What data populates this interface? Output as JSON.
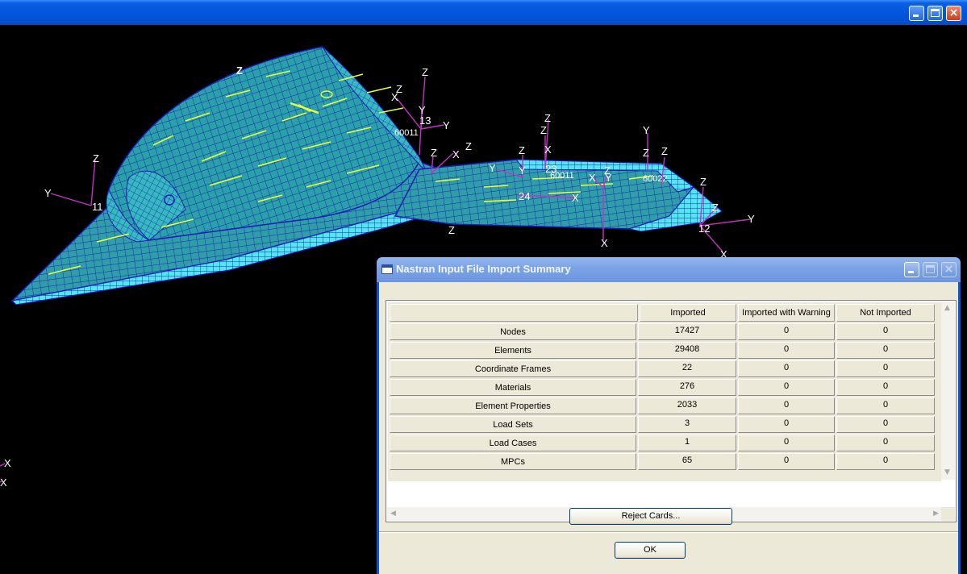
{
  "viewport": {
    "labels": [
      {
        "t": "Z"
      },
      {
        "t": "Z"
      },
      {
        "t": "Z"
      },
      {
        "t": "X"
      },
      {
        "t": "Y"
      },
      {
        "t": "13"
      },
      {
        "t": "Y"
      },
      {
        "t": "60011"
      },
      {
        "t": "Z"
      },
      {
        "t": "X"
      },
      {
        "t": "Z"
      },
      {
        "t": "Z"
      },
      {
        "t": "X"
      },
      {
        "t": "Z"
      },
      {
        "t": "Y"
      },
      {
        "t": "Z"
      },
      {
        "t": "Y"
      },
      {
        "t": "23"
      },
      {
        "t": "60011"
      },
      {
        "t": "X"
      },
      {
        "t": "Z"
      },
      {
        "t": "Y"
      },
      {
        "t": "Z"
      },
      {
        "t": "Z"
      },
      {
        "t": "60022"
      },
      {
        "t": "Y"
      },
      {
        "t": "24"
      },
      {
        "t": "X"
      },
      {
        "t": "Z"
      },
      {
        "t": "X"
      },
      {
        "t": "Z"
      },
      {
        "t": "Y"
      },
      {
        "t": "12"
      },
      {
        "t": "X"
      },
      {
        "t": "Z"
      },
      {
        "t": "Y"
      },
      {
        "t": "11"
      },
      {
        "t": "X"
      },
      {
        "t": "X"
      },
      {
        "t": "Z"
      }
    ]
  },
  "dialog": {
    "title": "Nastran Input File Import Summary",
    "columns": [
      "Imported",
      "Imported with Warning",
      "Not Imported"
    ],
    "rows": [
      {
        "label": "Nodes",
        "imported": "17427",
        "warning": "0",
        "not_imported": "0"
      },
      {
        "label": "Elements",
        "imported": "29408",
        "warning": "0",
        "not_imported": "0"
      },
      {
        "label": "Coordinate Frames",
        "imported": "22",
        "warning": "0",
        "not_imported": "0"
      },
      {
        "label": "Materials",
        "imported": "276",
        "warning": "0",
        "not_imported": "0"
      },
      {
        "label": "Element Properties",
        "imported": "2033",
        "warning": "0",
        "not_imported": "0"
      },
      {
        "label": "Load Sets",
        "imported": "3",
        "warning": "0",
        "not_imported": "0"
      },
      {
        "label": "Load Cases",
        "imported": "1",
        "warning": "0",
        "not_imported": "0"
      },
      {
        "label": "MPCs",
        "imported": "65",
        "warning": "0",
        "not_imported": "0"
      }
    ],
    "reject_button": "Reject Cards...",
    "ok_button": "OK"
  },
  "colors": {
    "mesh_fill": "#2aa7b0",
    "mesh_line": "#1a1ab8",
    "mesh_highlight": "#e6ff3c",
    "axis": "#c433c4",
    "axis_text": "#ffffff"
  }
}
